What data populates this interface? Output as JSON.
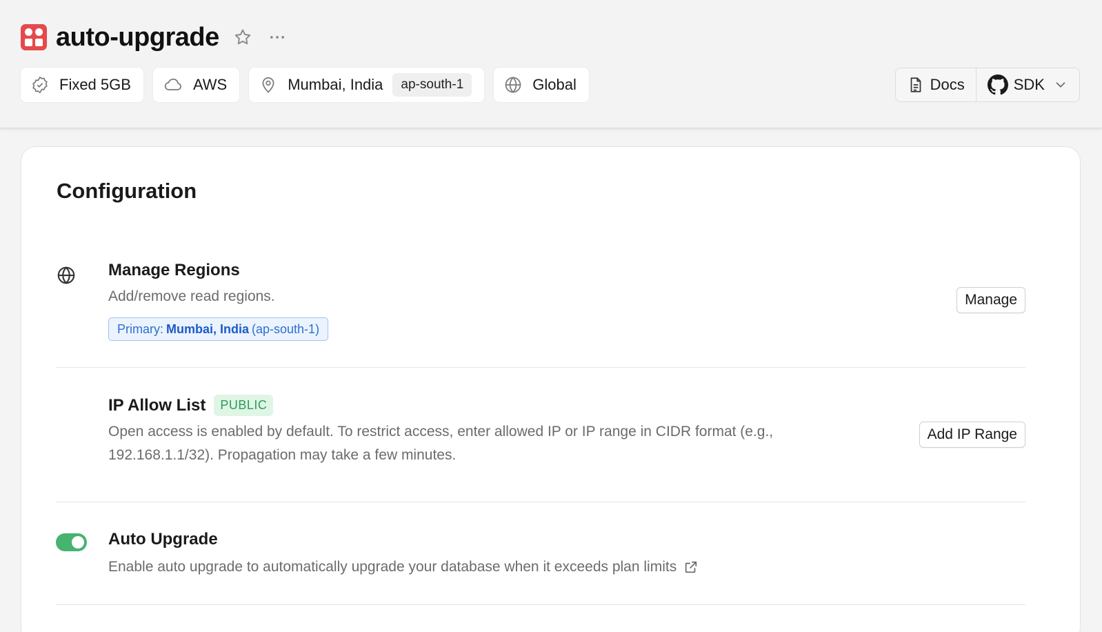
{
  "header": {
    "title": "auto-upgrade",
    "chips": {
      "plan": "Fixed 5GB",
      "cloud": "AWS",
      "location": "Mumbai, India",
      "region_code": "ap-south-1",
      "scope": "Global"
    },
    "docs_label": "Docs",
    "sdk_label": "SDK"
  },
  "config": {
    "title": "Configuration",
    "regions": {
      "title": "Manage Regions",
      "description": "Add/remove read regions.",
      "primary_prefix": "Primary:",
      "primary_location": "Mumbai, India",
      "primary_code": "(ap-south-1)",
      "button": "Manage"
    },
    "ip_allow": {
      "title": "IP Allow List",
      "badge": "PUBLIC",
      "description_line1": "Open access is enabled by default. To restrict access, enter allowed IP or IP range in CIDR format (e.g.,",
      "description_line2": "192.168.1.1/32). Propagation may take a few minutes.",
      "button": "Add IP Range"
    },
    "auto_upgrade": {
      "title": "Auto Upgrade",
      "description": "Enable auto upgrade to automatically upgrade your database when it exceeds plan limits",
      "enabled": true
    }
  },
  "colors": {
    "brand": "#e5484d",
    "toggle_on": "#46b36f",
    "badge_bg": "#dff5e6",
    "badge_text": "#2e9b57",
    "pill_border": "#9fc4f2",
    "pill_text": "#2f6fcf"
  },
  "icons": {
    "logo": "brand-logo-icon",
    "star": "star-icon",
    "more": "more-horizontal-icon",
    "plan": "badge-check-icon",
    "cloud": "cloud-icon",
    "location": "map-pin-icon",
    "scope": "globe-icon",
    "docs": "document-icon",
    "sdk": "github-icon",
    "regions": "globe-icon",
    "external": "external-link-icon"
  }
}
